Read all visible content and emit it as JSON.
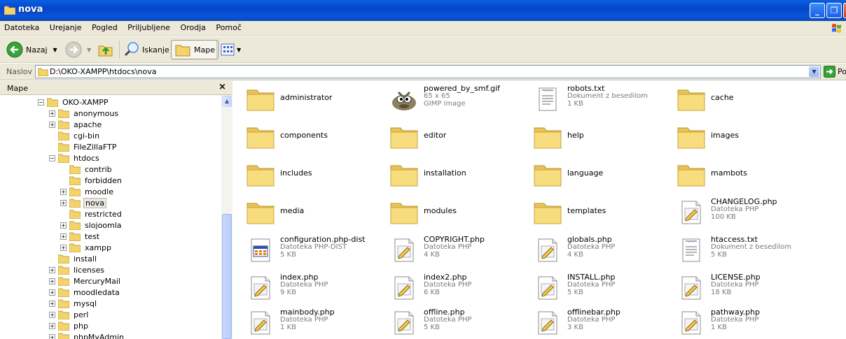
{
  "window": {
    "title": "nova"
  },
  "menu": [
    "Datoteka",
    "Urejanje",
    "Pogled",
    "Priljubljene",
    "Orodja",
    "Pomoč"
  ],
  "toolbar": {
    "back_label": "Nazaj",
    "search_label": "Iskanje",
    "folders_label": "Mape"
  },
  "address": {
    "label": "Naslov",
    "path": "D:\\OKO-XAMPP\\htdocs\\nova",
    "go_label": "Poj"
  },
  "pane": {
    "title": "Mape",
    "close": "×"
  },
  "tree": [
    {
      "label": "OKO-XAMPP",
      "expander": "−"
    },
    {
      "label": "anonymous",
      "expander": "+"
    },
    {
      "label": "apache",
      "expander": "+"
    },
    {
      "label": "cgi-bin",
      "expander": ""
    },
    {
      "label": "FileZillaFTP",
      "expander": ""
    },
    {
      "label": "htdocs",
      "expander": "−"
    },
    {
      "label": "contrib",
      "expander": ""
    },
    {
      "label": "forbidden",
      "expander": ""
    },
    {
      "label": "moodle",
      "expander": "+"
    },
    {
      "label": "nova",
      "expander": "+",
      "selected": true
    },
    {
      "label": "restricted",
      "expander": ""
    },
    {
      "label": "slojoomla",
      "expander": "+"
    },
    {
      "label": "test",
      "expander": "+"
    },
    {
      "label": "xampp",
      "expander": "+"
    },
    {
      "label": "install",
      "expander": ""
    },
    {
      "label": "licenses",
      "expander": "+"
    },
    {
      "label": "MercuryMail",
      "expander": "+"
    },
    {
      "label": "moodledata",
      "expander": "+"
    },
    {
      "label": "mysql",
      "expander": "+"
    },
    {
      "label": "perl",
      "expander": "+"
    },
    {
      "label": "php",
      "expander": "+"
    },
    {
      "label": "phpMyAdmin",
      "expander": "+"
    }
  ],
  "files": [
    {
      "name": "administrator",
      "kind": "folder"
    },
    {
      "name": "powered_by_smf.gif",
      "kind": "gimp",
      "meta1": "65 x 65",
      "meta2": "GIMP image"
    },
    {
      "name": "robots.txt",
      "kind": "txt",
      "meta1": "Dokument z besedilom",
      "meta2": "1 KB"
    },
    {
      "name": "cache",
      "kind": "folder"
    },
    {
      "name": "components",
      "kind": "folder"
    },
    {
      "name": "editor",
      "kind": "folder"
    },
    {
      "name": "help",
      "kind": "folder"
    },
    {
      "name": "images",
      "kind": "folder"
    },
    {
      "name": "includes",
      "kind": "folder"
    },
    {
      "name": "installation",
      "kind": "folder"
    },
    {
      "name": "language",
      "kind": "folder"
    },
    {
      "name": "mambots",
      "kind": "folder"
    },
    {
      "name": "media",
      "kind": "folder"
    },
    {
      "name": "modules",
      "kind": "folder"
    },
    {
      "name": "templates",
      "kind": "folder"
    },
    {
      "name": "CHANGELOG.php",
      "kind": "php",
      "meta1": "Datoteka PHP",
      "meta2": "100 KB"
    },
    {
      "name": "configuration.php-dist",
      "kind": "dist",
      "meta1": "Datoteka PHP-DIST",
      "meta2": "5 KB"
    },
    {
      "name": "COPYRIGHT.php",
      "kind": "php",
      "meta1": "Datoteka PHP",
      "meta2": "4 KB"
    },
    {
      "name": "globals.php",
      "kind": "php",
      "meta1": "Datoteka PHP",
      "meta2": "4 KB"
    },
    {
      "name": "htaccess.txt",
      "kind": "txt",
      "meta1": "Dokument z besedilom",
      "meta2": "5 KB"
    },
    {
      "name": "index.php",
      "kind": "php",
      "meta1": "Datoteka PHP",
      "meta2": "9 KB"
    },
    {
      "name": "index2.php",
      "kind": "php",
      "meta1": "Datoteka PHP",
      "meta2": "6 KB"
    },
    {
      "name": "INSTALL.php",
      "kind": "php",
      "meta1": "Datoteka PHP",
      "meta2": "5 KB"
    },
    {
      "name": "LICENSE.php",
      "kind": "php",
      "meta1": "Datoteka PHP",
      "meta2": "18 KB"
    },
    {
      "name": "mainbody.php",
      "kind": "php",
      "meta1": "Datoteka PHP",
      "meta2": "1 KB"
    },
    {
      "name": "offline.php",
      "kind": "php",
      "meta1": "Datoteka PHP",
      "meta2": "5 KB"
    },
    {
      "name": "offlinebar.php",
      "kind": "php",
      "meta1": "Datoteka PHP",
      "meta2": "3 KB"
    },
    {
      "name": "pathway.php",
      "kind": "php",
      "meta1": "Datoteka PHP",
      "meta2": "1 KB"
    }
  ],
  "colors": {
    "titlebar": "#0a54d8",
    "chrome": "#ece9d8",
    "folder": "#f5d76e",
    "meta_text": "#7b7b7b"
  }
}
